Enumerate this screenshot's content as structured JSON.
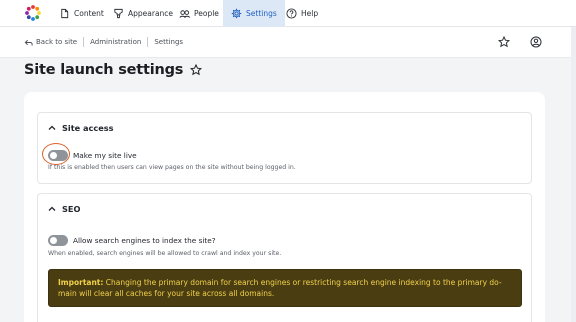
{
  "toolbar": {
    "items": [
      {
        "label": "Content",
        "icon": "file-icon"
      },
      {
        "label": "Appearance",
        "icon": "brush-icon"
      },
      {
        "label": "People",
        "icon": "people-icon"
      },
      {
        "label": "Settings",
        "icon": "gear-icon"
      },
      {
        "label": "Help",
        "icon": "help-icon"
      }
    ],
    "active": "Settings"
  },
  "breadcrumb": {
    "back": "Back to site",
    "items": [
      "Administration",
      "Settings"
    ]
  },
  "page": {
    "title": "Site launch settings"
  },
  "site_access": {
    "heading": "Site access",
    "toggle_label": "Make my site live",
    "toggle_on": false,
    "help": "If this is enabled then users can view pages on the site without being logged in."
  },
  "seo": {
    "heading": "SEO",
    "toggle_label": "Allow search engines to index the site?",
    "toggle_on": false,
    "help": "When enabled, search engines will be allowed to crawl and index your site.",
    "warning_strong": "Important:",
    "warning_line1": "Changing the primary domain for search engines or restricting search engine indexing to the primary do-",
    "warning_line2": "main will clear all caches for your site across all domains."
  },
  "colors": {
    "accent": "#1f5fbf",
    "active_bg": "#dde8f7",
    "warning_bg": "#4a3d12",
    "warning_text": "#f2d14a",
    "focus_ring": "#d9622b"
  }
}
